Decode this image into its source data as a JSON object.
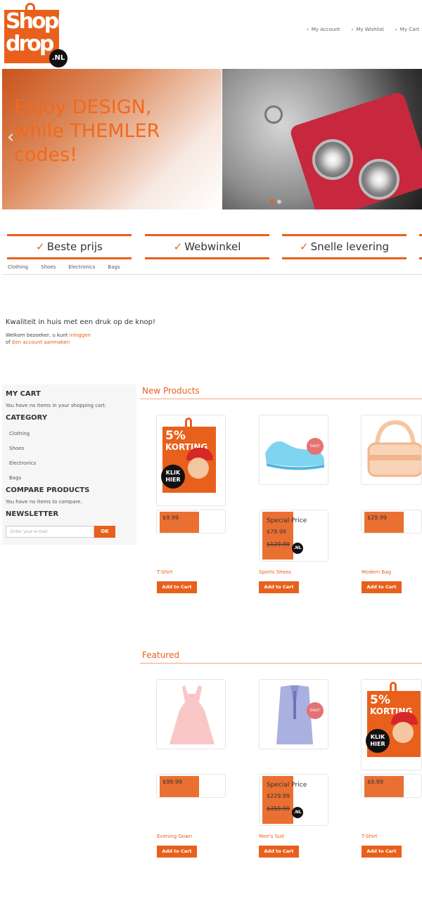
{
  "header": {
    "logo_line1": "Shopn",
    "logo_line2": "drop",
    "logo_badge": ".NL",
    "links": [
      "My Account",
      "My Wishlist",
      "My Cart"
    ]
  },
  "hero": {
    "text": "Enjoy DESIGN, while THEMLER codes!",
    "prev_label": "‹"
  },
  "usps": [
    "Beste prijs",
    "Webwinkel",
    "Snelle levering"
  ],
  "category_nav": [
    "Clothing",
    "Shoes",
    "Electronics",
    "Bags"
  ],
  "welcome": {
    "heading": "Kwaliteit in huis met een druk op de knop!",
    "line1_prefix": "Welkom bezoeker, u kunt ",
    "login_link": "inloggen",
    "line2_prefix": "of ",
    "register_link": "Een account aanmaken"
  },
  "sidebar": {
    "cart_title": "MY CART",
    "cart_text": "You have no items in your shopping cart.",
    "category_title": "CATEGORY",
    "categories": [
      "Clothing",
      "Shoes",
      "Electronics",
      "Bags"
    ],
    "compare_title": "COMPARE PRODUCTS",
    "compare_text": "You have no items to compare.",
    "newsletter_title": "NEWSLETTER",
    "newsletter_placeholder": "Enter your e-mail",
    "newsletter_button": "OK"
  },
  "promo": {
    "percent": "5%",
    "korting": "KORTING",
    "klik": "KLIK HIER"
  },
  "sale_label": "SALE!",
  "new_products": {
    "title": "New Products",
    "items": [
      {
        "name": "T-Shirt",
        "price": "$9.99",
        "button": "Add to Cart"
      },
      {
        "name": "Sports Shoes",
        "special_label": "Special Price",
        "new_price": "$79.99",
        "old_price": "$129.99",
        "button": "Add to Cart"
      },
      {
        "name": "Modern Bag",
        "price": "$29.99",
        "button": "Add to Cart"
      }
    ]
  },
  "featured": {
    "title": "Featured",
    "items": [
      {
        "name": "Evening Gown",
        "price": "$99.99",
        "button": "Add to Cart"
      },
      {
        "name": "Men's Suit",
        "special_label": "Special Price",
        "new_price": "$229.99",
        "old_price": "$359.99",
        "button": "Add to Cart"
      },
      {
        "name": "T-Shirt",
        "price": "$9.99",
        "button": "Add to Cart"
      }
    ]
  },
  "colors": {
    "accent": "#e8601c",
    "sidebar_bg": "#f6f6f6"
  }
}
